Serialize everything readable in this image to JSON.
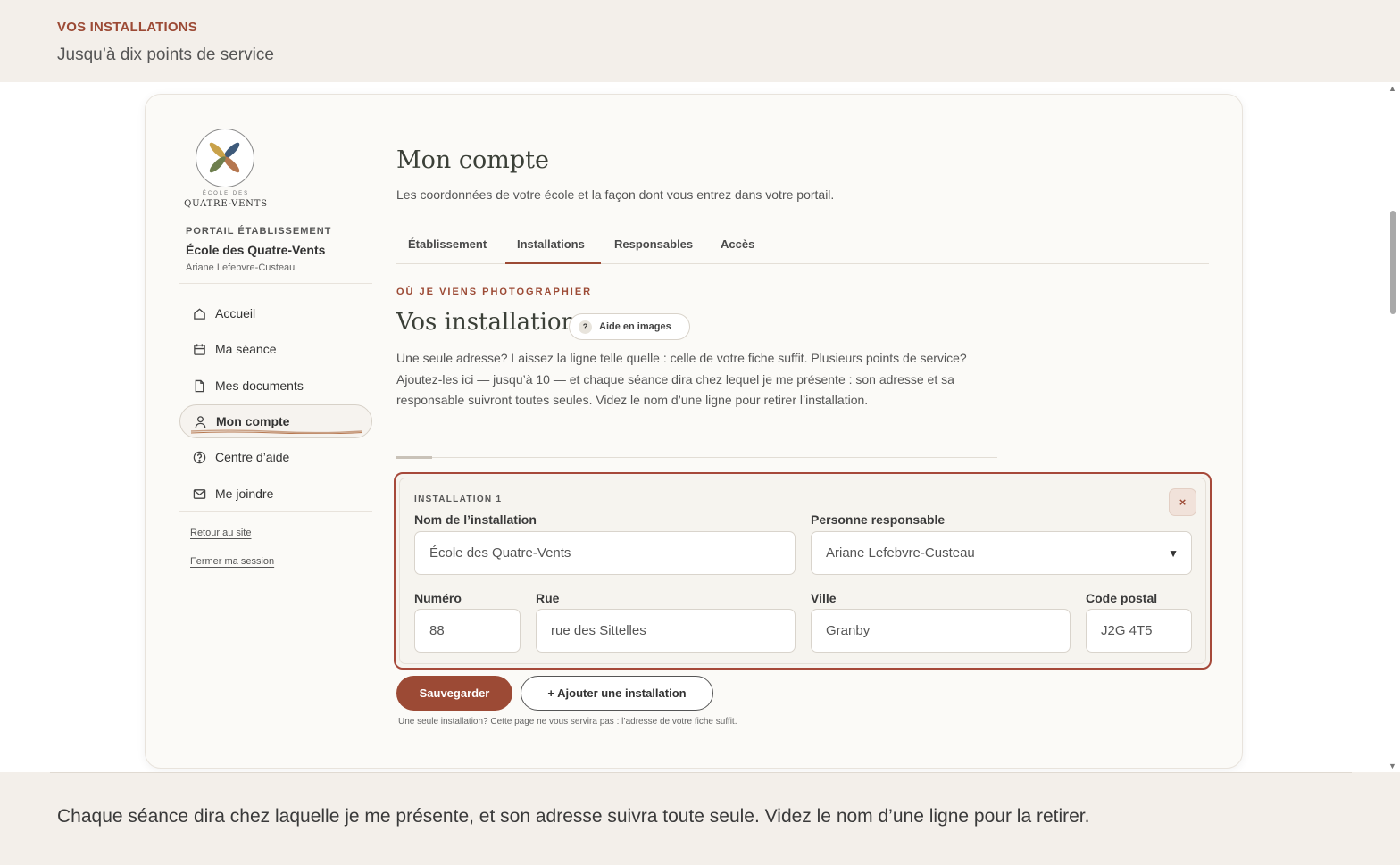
{
  "header": {
    "eyebrow": "VOS INSTALLATIONS",
    "subtitle": "Jusqu’à dix points de service"
  },
  "sidebar": {
    "logo_small": "ÉCOLE DES",
    "logo_name": "QUATRE-VENTS",
    "portal_label": "PORTAIL ÉTABLISSEMENT",
    "school_name": "École des Quatre-Vents",
    "user_name": "Ariane Lefebvre-Custeau",
    "items": [
      {
        "label": "Accueil",
        "icon": "home-icon"
      },
      {
        "label": "Ma séance",
        "icon": "calendar-icon"
      },
      {
        "label": "Mes documents",
        "icon": "document-icon"
      },
      {
        "label": "Mon compte",
        "icon": "user-icon",
        "active": true
      },
      {
        "label": "Centre d’aide",
        "icon": "help-circle-icon"
      },
      {
        "label": "Me joindre",
        "icon": "mail-icon"
      }
    ],
    "links": [
      "Retour au site",
      "Fermer ma session"
    ]
  },
  "main": {
    "title": "Mon compte",
    "description": "Les coordonnées de votre école et la façon dont vous entrez dans votre portail.",
    "tabs": [
      {
        "label": "Établissement"
      },
      {
        "label": "Installations",
        "active": true
      },
      {
        "label": "Responsables"
      },
      {
        "label": "Accès"
      }
    ],
    "section": {
      "eyebrow": "OÙ JE VIENS PHOTOGRAPHIER",
      "title": "Vos installations",
      "help_button": "Aide en images",
      "description": "Une seule adresse? Laissez la ligne telle quelle : celle de votre fiche suffit. Plusieurs points de service? Ajoutez-les ici — jusqu’à 10 — et chaque séance dira chez lequel je me présente : son adresse et sa responsable suivront toutes seules. Videz le nom d’une ligne pour retirer l’installation.",
      "progress_fraction": 0.06
    },
    "installation": {
      "label": "INSTALLATION 1",
      "remove_label": "×",
      "name_label": "Nom de l’installation",
      "name_value": "École des Quatre-Vents",
      "responsible_label": "Personne responsable",
      "responsible_value": "Ariane Lefebvre-Custeau",
      "number_label": "Numéro",
      "number_value": "88",
      "street_label": "Rue",
      "street_value": "rue des Sittelles",
      "city_label": "Ville",
      "city_value": "Granby",
      "postal_label": "Code postal",
      "postal_value": "J2G 4T5"
    },
    "save_button": "Sauvegarder",
    "add_button": "+ Ajouter une installation",
    "footnote": "Une seule installation? Cette page ne vous servira pas : l’adresse de votre fiche suffit."
  },
  "caption": "Chaque séance dira chez laquelle je me présente, et son adresse suivra toute seule. Videz le nom d’une ligne pour la retirer.",
  "colors": {
    "accent": "#9c4a35",
    "background": "#f3efea",
    "card": "#fbfaf7"
  }
}
